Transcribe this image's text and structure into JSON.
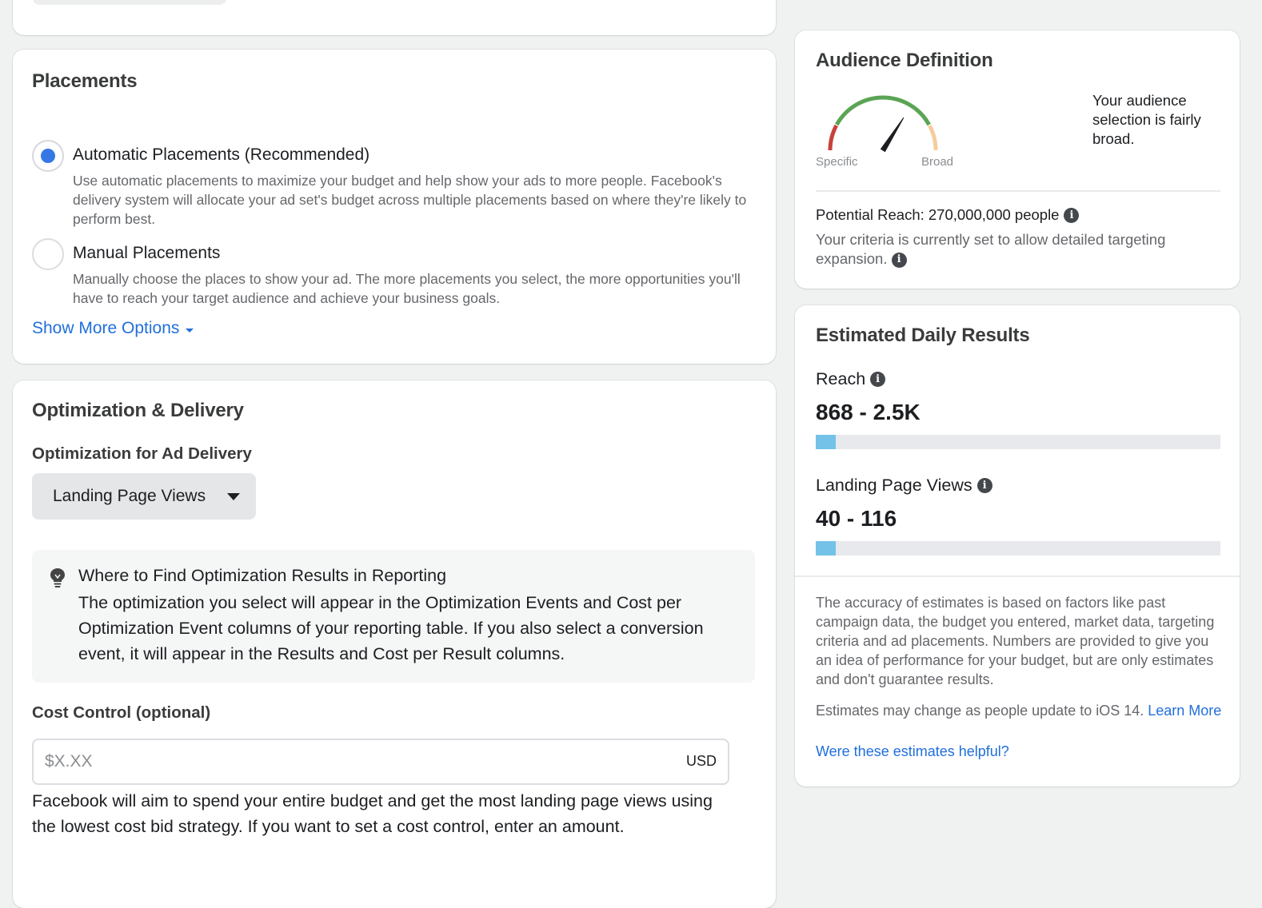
{
  "placements": {
    "title": "Placements",
    "options": [
      {
        "label": "Automatic Placements (Recommended)",
        "description": "Use automatic placements to maximize your budget and help show your ads to more people. Facebook's delivery system will allocate your ad set's budget across multiple placements based on where they're likely to perform best.",
        "selected": true
      },
      {
        "label": "Manual Placements",
        "description": "Manually choose the places to show your ad. The more placements you select, the more opportunities you'll have to reach your target audience and achieve your business goals.",
        "selected": false
      }
    ],
    "show_more_label": "Show More Options"
  },
  "optimization": {
    "title": "Optimization & Delivery",
    "delivery_label": "Optimization for Ad Delivery",
    "delivery_selected": "Landing Page Views",
    "info_box": {
      "icon": "lightbulb-icon",
      "title": "Where to Find Optimization Results in Reporting",
      "body": "The optimization you select will appear in the Optimization Events and Cost per Optimization Event columns of your reporting table. If you also select a conversion event, it will appear in the Results and Cost per Result columns."
    },
    "cost_control_label": "Cost Control (optional)",
    "cost_control_placeholder": "$X.XX",
    "cost_control_value": "",
    "cost_control_currency": "USD",
    "cost_control_help": "Facebook will aim to spend your entire budget and get the most landing page views using the lowest cost bid strategy. If you want to set a cost control, enter an amount."
  },
  "audience": {
    "title": "Audience Definition",
    "gauge_min_label": "Specific",
    "gauge_max_label": "Broad",
    "gauge_level": 0.68,
    "gauge_colors": {
      "specific": "#c9413b",
      "middle": "#5aa454",
      "broad": "#f5cd9c",
      "needle": "#1c1e21"
    },
    "status_text": "Your audience selection is fairly broad.",
    "potential_reach": "Potential Reach: 270,000,000 people",
    "expansion_text": "Your criteria is currently set to allow detailed targeting expansion."
  },
  "estimates": {
    "title": "Estimated Daily Results",
    "metrics": [
      {
        "label": "Reach",
        "value": "868 - 2.5K",
        "bar_fraction": 0.05
      },
      {
        "label": "Landing Page Views",
        "value": "40 - 116",
        "bar_fraction": 0.05
      }
    ],
    "bar_color": "#74c2e8",
    "disclaimer": "The accuracy of estimates is based on factors like past campaign data, the budget you entered, market data, targeting criteria and ad placements. Numbers are provided to give you an idea of performance for your budget, but are only estimates and don't guarantee results.",
    "ios_text": "Estimates may change as people update to iOS 14.",
    "learn_more_label": "Learn More",
    "helpful_label": "Were these estimates helpful?"
  }
}
